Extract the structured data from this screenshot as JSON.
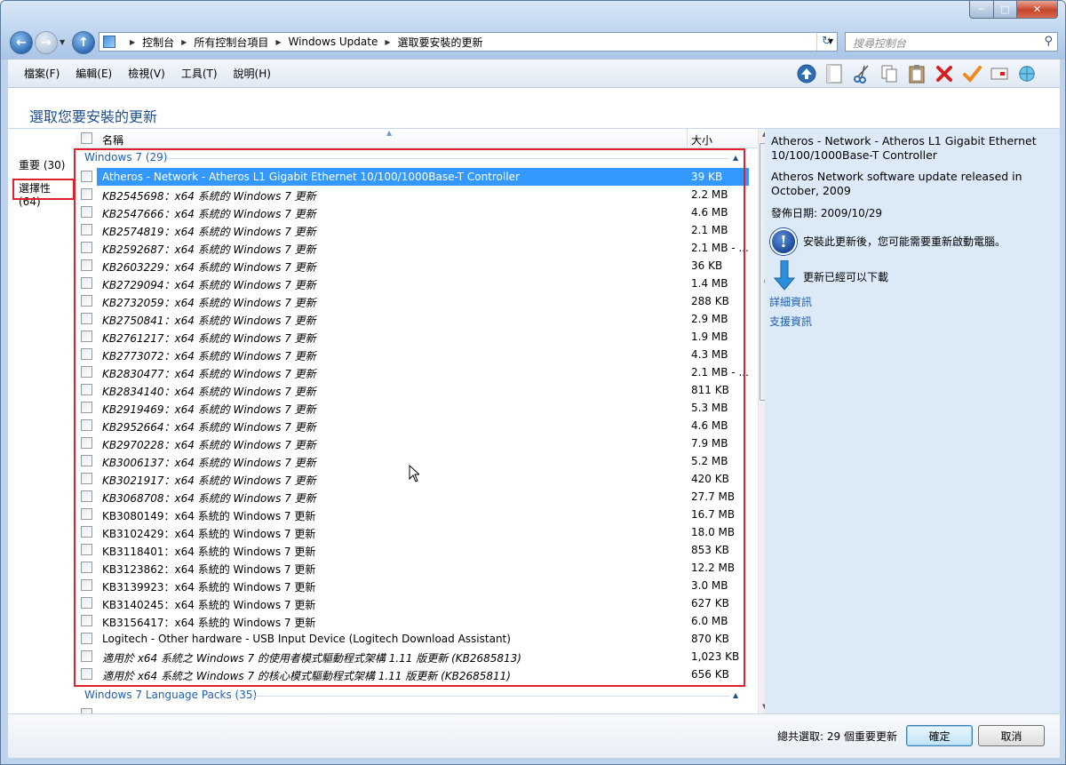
{
  "address": {
    "crumbs": [
      "控制台",
      "所有控制台項目",
      "Windows Update",
      "選取要安裝的更新"
    ],
    "search_placeholder": "搜尋控制台"
  },
  "menu": {
    "items": [
      "檔案(F)",
      "編輯(E)",
      "檢視(V)",
      "工具(T)",
      "說明(H)"
    ]
  },
  "toolbar_icons": [
    "up-icon",
    "blank-page-icon",
    "scissors-icon",
    "copy-icon",
    "paste-icon",
    "delete-icon",
    "check-icon",
    "properties-icon",
    "globe-icon"
  ],
  "page": {
    "title": "選取您要安裝的更新"
  },
  "categories": {
    "important": "重要 (30)",
    "optional": "選擇性 (64)"
  },
  "columns": {
    "name": "名稱",
    "size": "大小"
  },
  "groups": {
    "win7": "Windows 7 (29)",
    "langpacks": "Windows 7 Language Packs (35)"
  },
  "updates": [
    {
      "name": "Atheros - Network - Atheros L1 Gigabit Ethernet 10/100/1000Base-T Controller",
      "size": "39 KB"
    },
    {
      "name": "KB2545698：x64 系統的 Windows 7 更新",
      "size": "2.2 MB"
    },
    {
      "name": "KB2547666：x64 系統的 Windows 7 更新",
      "size": "4.6 MB"
    },
    {
      "name": "KB2574819：x64 系統的 Windows 7 更新",
      "size": "2.1 MB"
    },
    {
      "name": "KB2592687：x64 系統的 Windows 7 更新",
      "size": "2.1 MB - ..."
    },
    {
      "name": "KB2603229：x64 系統的 Windows 7 更新",
      "size": "36 KB"
    },
    {
      "name": "KB2729094：x64 系統的 Windows 7 更新",
      "size": "1.4 MB"
    },
    {
      "name": "KB2732059：x64 系統的 Windows 7 更新",
      "size": "288 KB"
    },
    {
      "name": "KB2750841：x64 系統的 Windows 7 更新",
      "size": "2.9 MB"
    },
    {
      "name": "KB2761217：x64 系統的 Windows 7 更新",
      "size": "1.9 MB"
    },
    {
      "name": "KB2773072：x64 系統的 Windows 7 更新",
      "size": "4.3 MB"
    },
    {
      "name": "KB2830477：x64 系統的 Windows 7 更新",
      "size": "2.1 MB - ..."
    },
    {
      "name": "KB2834140：x64 系統的 Windows 7 更新",
      "size": "811 KB"
    },
    {
      "name": "KB2919469：x64 系統的 Windows 7 更新",
      "size": "5.3 MB"
    },
    {
      "name": "KB2952664：x64 系統的 Windows 7 更新",
      "size": "4.6 MB"
    },
    {
      "name": "KB2970228：x64 系統的 Windows 7 更新",
      "size": "7.9 MB"
    },
    {
      "name": "KB3006137：x64 系統的 Windows 7 更新",
      "size": "5.2 MB"
    },
    {
      "name": "KB3021917：x64 系統的 Windows 7 更新",
      "size": "420 KB"
    },
    {
      "name": "KB3068708：x64 系統的 Windows 7 更新",
      "size": "27.7 MB"
    },
    {
      "name": "KB3080149：x64 系統的 Windows 7 更新",
      "size": "16.7 MB"
    },
    {
      "name": "KB3102429：x64 系統的 Windows 7 更新",
      "size": "18.0 MB"
    },
    {
      "name": "KB3118401：x64 系統的 Windows 7 更新",
      "size": "853 KB"
    },
    {
      "name": "KB3123862：x64 系統的 Windows 7 更新",
      "size": "12.2 MB"
    },
    {
      "name": "KB3139923：x64 系統的 Windows 7 更新",
      "size": "3.0 MB"
    },
    {
      "name": "KB3140245：x64 系統的 Windows 7 更新",
      "size": "627 KB"
    },
    {
      "name": "KB3156417：x64 系統的 Windows 7 更新",
      "size": "6.0 MB"
    },
    {
      "name": "Logitech - Other hardware - USB Input Device (Logitech Download Assistant)",
      "size": "870 KB"
    },
    {
      "name": "適用於 x64 系統之 Windows 7 的使用者模式驅動程式架構 1.11 版更新 (KB2685813)",
      "size": "1,023 KB"
    },
    {
      "name": "適用於 x64 系統之 Windows 7 的核心模式驅動程式架構 1.11 版更新 (KB2685811)",
      "size": "656 KB"
    }
  ],
  "details": {
    "title": "Atheros - Network - Atheros L1 Gigabit Ethernet 10/100/1000Base-T Controller",
    "description": "Atheros Network software update released in October, 2009",
    "date_label": "發佈日期:",
    "date_value": "2009/10/29",
    "restart_note": "安裝此更新後，您可能需要重新啟動電腦。",
    "download_note": "更新已經可以下載",
    "more_info": "詳細資訊",
    "support_info": "支援資訊"
  },
  "footer": {
    "summary": "總共選取: 29 個重要更新",
    "ok": "確定",
    "cancel": "取消"
  },
  "colors": {
    "selection": "#3399ff",
    "highlight_box": "#e0202a",
    "link": "#1e5fb4"
  }
}
